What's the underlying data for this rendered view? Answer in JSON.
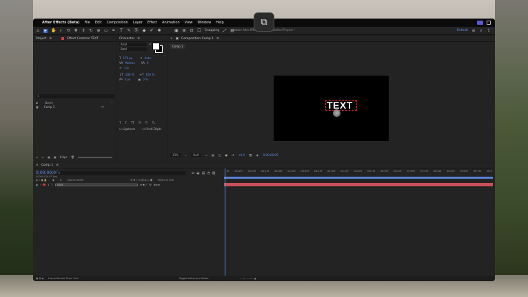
{
  "pip_button": {
    "icon": "exit-picture-in-picture-icon",
    "glyph": "⧉"
  },
  "menubar": {
    "apple": "",
    "app_name": "After Effects (Beta)",
    "items": [
      "File",
      "Edit",
      "Composition",
      "Layer",
      "Effect",
      "Animation",
      "View",
      "Window",
      "Help"
    ]
  },
  "window_title": "Adobe After Effects (Beta) - Untitled Project *",
  "toolbar": {
    "snapping_label": "Snapping",
    "workspace_label": "Default"
  },
  "project_panel": {
    "title": "Project",
    "effect_controls_label": "Effect Controls TEXT",
    "search_placeholder": "Q",
    "col_name": "Name",
    "item_name": "Comp 1",
    "bpc": "8 bpc"
  },
  "character_panel": {
    "title": "Character",
    "font": "Arial",
    "style": "Bold",
    "size": "170 px",
    "leading": "Auto",
    "kerning": "Metrics",
    "tracking": "0",
    "stroke": "- px",
    "vscale": "100 %",
    "hscale": "100 %",
    "baseline": "0 px",
    "tsume": "0 %",
    "ligatures_label": "Ligatures",
    "hindi_label": "Hindi Digits"
  },
  "composition_panel": {
    "title": "Composition Comp 1",
    "tab": "Comp 1",
    "text_layer": "TEXT",
    "zoom": "33%",
    "resolution": "Half",
    "exposure": "+0.0",
    "timecode": "0;00;00;00"
  },
  "timeline": {
    "tab": "Comp 1",
    "timecode": "0;00;00;00",
    "timecode_sub": "00000 (29.97 fps)",
    "search_placeholder": "Q",
    "col_source": "Source Name",
    "col_parent": "Parent & Link",
    "layer_index": "1",
    "layer_name": "TEXT",
    "layer_parent": "None",
    "ruler_ticks": [
      "0f",
      "00:15f",
      "01:00f",
      "01:15f",
      "02:00f",
      "02:15f",
      "03:00f",
      "03:15f",
      "04:00f",
      "04:15f",
      "05:00f",
      "05:15f",
      "06:00f",
      "06:15f",
      "07:00f",
      "07:15f",
      "08:00f",
      "08:15f",
      "09:00f",
      "09:15f",
      "10:0"
    ],
    "footer_render": "Frame Render Time: 0ms",
    "footer_toggle": "Toggle Switches / Modes"
  }
}
